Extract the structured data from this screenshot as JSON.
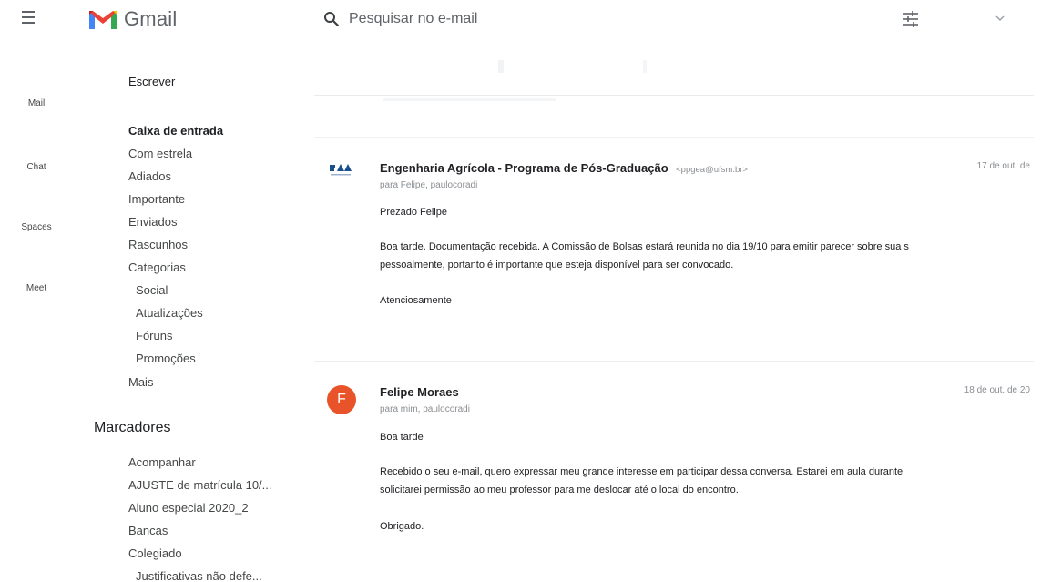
{
  "header": {
    "app_name": "Gmail",
    "search_placeholder": "Pesquisar no e-mail"
  },
  "rail": {
    "items": [
      {
        "label": "Mail"
      },
      {
        "label": "Chat"
      },
      {
        "label": "Spaces"
      },
      {
        "label": "Meet"
      }
    ]
  },
  "nav": {
    "compose_label": "Escrever",
    "items": [
      {
        "label": "Caixa de entrada"
      },
      {
        "label": "Com estrela"
      },
      {
        "label": "Adiados"
      },
      {
        "label": "Importante"
      },
      {
        "label": "Enviados"
      },
      {
        "label": "Rascunhos"
      },
      {
        "label": "Categorias"
      },
      {
        "label": "Social"
      },
      {
        "label": "Atualizações"
      },
      {
        "label": "Fóruns"
      },
      {
        "label": "Promoções"
      },
      {
        "label": "Mais"
      }
    ]
  },
  "labels": {
    "title": "Marcadores",
    "items": [
      {
        "label": "Acompanhar"
      },
      {
        "label": "AJUSTE de matrícula 10/..."
      },
      {
        "label": "Aluno especial 2020_2"
      },
      {
        "label": "Bancas"
      },
      {
        "label": "Colegiado"
      },
      {
        "label": "Justificativas não defe..."
      }
    ]
  },
  "messages": [
    {
      "sender": "Engenharia Agrícola - Programa de Pós-Graduação",
      "sender_email": "<ppgea@ufsm.br>",
      "recipients": "para Felipe, paulocoradi",
      "date": "17 de out. de",
      "greeting": "Prezado Felipe",
      "lines": [
        "Boa tarde. Documentação recebida. A Comissão de Bolsas estará reunida no dia 19/10 para emitir parecer sobre sua s",
        "pessoalmente, portanto é importante que esteja disponível para ser convocado."
      ],
      "closing": "Atenciosamente",
      "avatar": "ufsm-logo-icon"
    },
    {
      "sender": "Felipe Moraes",
      "recipients": "para mim, paulocoradi",
      "date": "18 de out. de 20",
      "greeting": "Boa tarde",
      "lines": [
        "Recebido o seu e-mail, quero expressar meu grande interesse em participar dessa conversa. Estarei em aula durante",
        "solicitarei permissão ao meu professor para me deslocar até o local do encontro."
      ],
      "closing": "Obrigado.",
      "avatar_letter": "F",
      "avatar_color": "#e8532a"
    }
  ]
}
